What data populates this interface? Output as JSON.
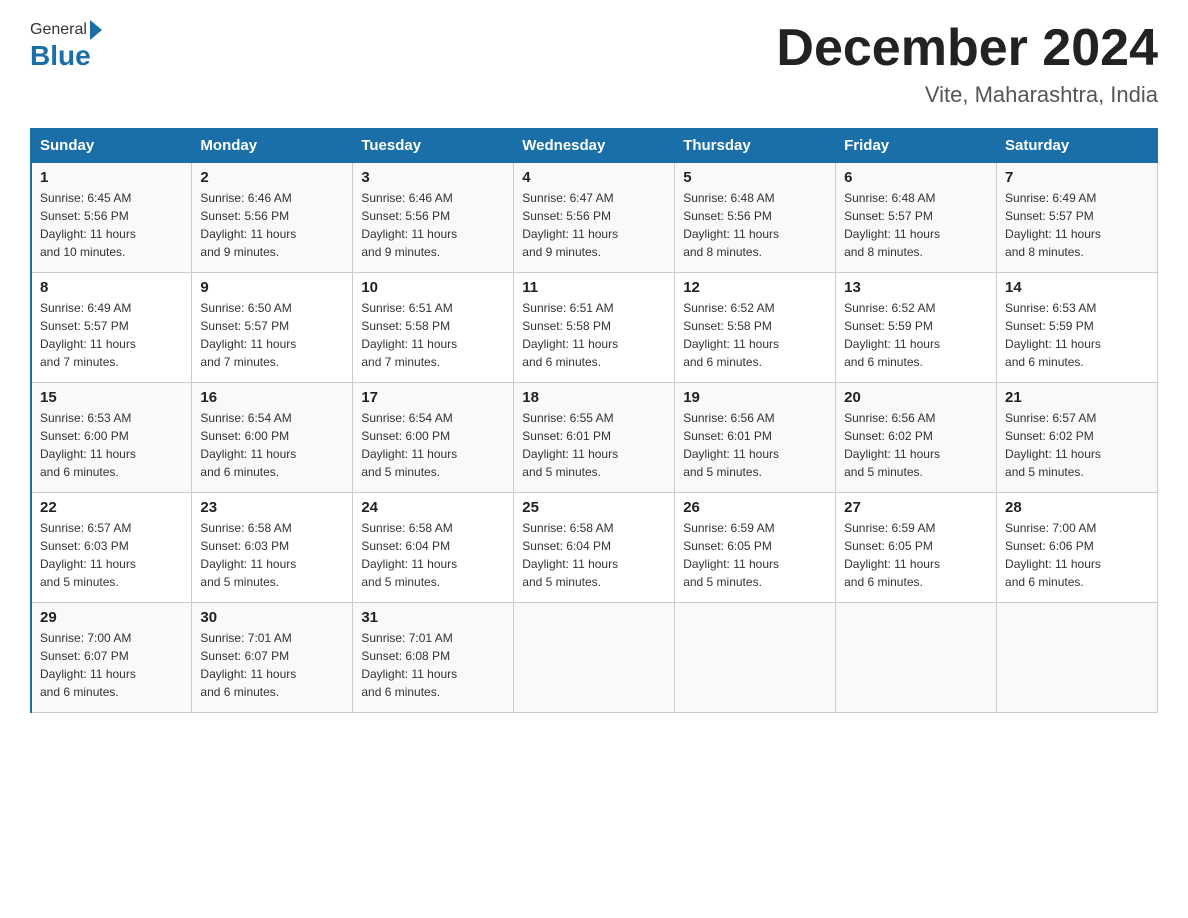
{
  "header": {
    "logo_general": "General",
    "logo_blue": "Blue",
    "month_title": "December 2024",
    "location": "Vite, Maharashtra, India"
  },
  "days_of_week": [
    "Sunday",
    "Monday",
    "Tuesday",
    "Wednesday",
    "Thursday",
    "Friday",
    "Saturday"
  ],
  "weeks": [
    [
      {
        "day": "1",
        "sunrise": "6:45 AM",
        "sunset": "5:56 PM",
        "daylight": "11 hours and 10 minutes."
      },
      {
        "day": "2",
        "sunrise": "6:46 AM",
        "sunset": "5:56 PM",
        "daylight": "11 hours and 9 minutes."
      },
      {
        "day": "3",
        "sunrise": "6:46 AM",
        "sunset": "5:56 PM",
        "daylight": "11 hours and 9 minutes."
      },
      {
        "day": "4",
        "sunrise": "6:47 AM",
        "sunset": "5:56 PM",
        "daylight": "11 hours and 9 minutes."
      },
      {
        "day": "5",
        "sunrise": "6:48 AM",
        "sunset": "5:56 PM",
        "daylight": "11 hours and 8 minutes."
      },
      {
        "day": "6",
        "sunrise": "6:48 AM",
        "sunset": "5:57 PM",
        "daylight": "11 hours and 8 minutes."
      },
      {
        "day": "7",
        "sunrise": "6:49 AM",
        "sunset": "5:57 PM",
        "daylight": "11 hours and 8 minutes."
      }
    ],
    [
      {
        "day": "8",
        "sunrise": "6:49 AM",
        "sunset": "5:57 PM",
        "daylight": "11 hours and 7 minutes."
      },
      {
        "day": "9",
        "sunrise": "6:50 AM",
        "sunset": "5:57 PM",
        "daylight": "11 hours and 7 minutes."
      },
      {
        "day": "10",
        "sunrise": "6:51 AM",
        "sunset": "5:58 PM",
        "daylight": "11 hours and 7 minutes."
      },
      {
        "day": "11",
        "sunrise": "6:51 AM",
        "sunset": "5:58 PM",
        "daylight": "11 hours and 6 minutes."
      },
      {
        "day": "12",
        "sunrise": "6:52 AM",
        "sunset": "5:58 PM",
        "daylight": "11 hours and 6 minutes."
      },
      {
        "day": "13",
        "sunrise": "6:52 AM",
        "sunset": "5:59 PM",
        "daylight": "11 hours and 6 minutes."
      },
      {
        "day": "14",
        "sunrise": "6:53 AM",
        "sunset": "5:59 PM",
        "daylight": "11 hours and 6 minutes."
      }
    ],
    [
      {
        "day": "15",
        "sunrise": "6:53 AM",
        "sunset": "6:00 PM",
        "daylight": "11 hours and 6 minutes."
      },
      {
        "day": "16",
        "sunrise": "6:54 AM",
        "sunset": "6:00 PM",
        "daylight": "11 hours and 6 minutes."
      },
      {
        "day": "17",
        "sunrise": "6:54 AM",
        "sunset": "6:00 PM",
        "daylight": "11 hours and 5 minutes."
      },
      {
        "day": "18",
        "sunrise": "6:55 AM",
        "sunset": "6:01 PM",
        "daylight": "11 hours and 5 minutes."
      },
      {
        "day": "19",
        "sunrise": "6:56 AM",
        "sunset": "6:01 PM",
        "daylight": "11 hours and 5 minutes."
      },
      {
        "day": "20",
        "sunrise": "6:56 AM",
        "sunset": "6:02 PM",
        "daylight": "11 hours and 5 minutes."
      },
      {
        "day": "21",
        "sunrise": "6:57 AM",
        "sunset": "6:02 PM",
        "daylight": "11 hours and 5 minutes."
      }
    ],
    [
      {
        "day": "22",
        "sunrise": "6:57 AM",
        "sunset": "6:03 PM",
        "daylight": "11 hours and 5 minutes."
      },
      {
        "day": "23",
        "sunrise": "6:58 AM",
        "sunset": "6:03 PM",
        "daylight": "11 hours and 5 minutes."
      },
      {
        "day": "24",
        "sunrise": "6:58 AM",
        "sunset": "6:04 PM",
        "daylight": "11 hours and 5 minutes."
      },
      {
        "day": "25",
        "sunrise": "6:58 AM",
        "sunset": "6:04 PM",
        "daylight": "11 hours and 5 minutes."
      },
      {
        "day": "26",
        "sunrise": "6:59 AM",
        "sunset": "6:05 PM",
        "daylight": "11 hours and 5 minutes."
      },
      {
        "day": "27",
        "sunrise": "6:59 AM",
        "sunset": "6:05 PM",
        "daylight": "11 hours and 6 minutes."
      },
      {
        "day": "28",
        "sunrise": "7:00 AM",
        "sunset": "6:06 PM",
        "daylight": "11 hours and 6 minutes."
      }
    ],
    [
      {
        "day": "29",
        "sunrise": "7:00 AM",
        "sunset": "6:07 PM",
        "daylight": "11 hours and 6 minutes."
      },
      {
        "day": "30",
        "sunrise": "7:01 AM",
        "sunset": "6:07 PM",
        "daylight": "11 hours and 6 minutes."
      },
      {
        "day": "31",
        "sunrise": "7:01 AM",
        "sunset": "6:08 PM",
        "daylight": "11 hours and 6 minutes."
      },
      null,
      null,
      null,
      null
    ]
  ],
  "labels": {
    "sunrise": "Sunrise:",
    "sunset": "Sunset:",
    "daylight": "Daylight:"
  }
}
